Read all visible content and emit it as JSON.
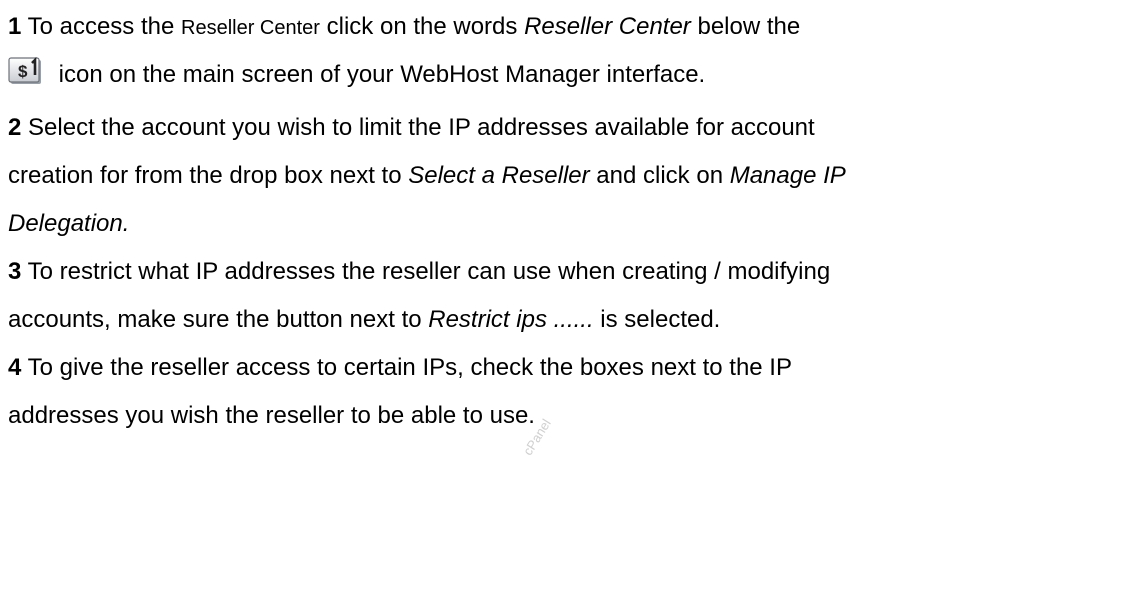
{
  "steps": [
    {
      "number": "1",
      "line1": {
        "a": "To access the ",
        "b": "Reseller Center",
        "c": " click on the words ",
        "d": "Reseller Center",
        "e": " below the"
      },
      "line2": " icon on the main screen of your WebHost Manager interface."
    },
    {
      "number": "2",
      "line1": "Select the account you wish to limit the IP addresses available for account",
      "line2": {
        "a": "creation for from the drop box next to ",
        "b": "Select a Reseller",
        "c": " and click on ",
        "d": "Manage IP"
      },
      "line3": "Delegation."
    },
    {
      "number": "3",
      "line1": "To restrict what IP addresses the reseller can use when creating / modifying",
      "line2": {
        "a": "accounts, make sure the button next to ",
        "b": "Restrict ips ......",
        "c": " is selected."
      }
    },
    {
      "number": "4",
      "line1": "To give the reseller access to certain IPs, check the boxes next to the IP",
      "line2": "addresses you wish the reseller to be able to use."
    }
  ],
  "icon": {
    "name": "reseller-center-icon",
    "glyph": "$"
  },
  "watermark": "cPanel"
}
